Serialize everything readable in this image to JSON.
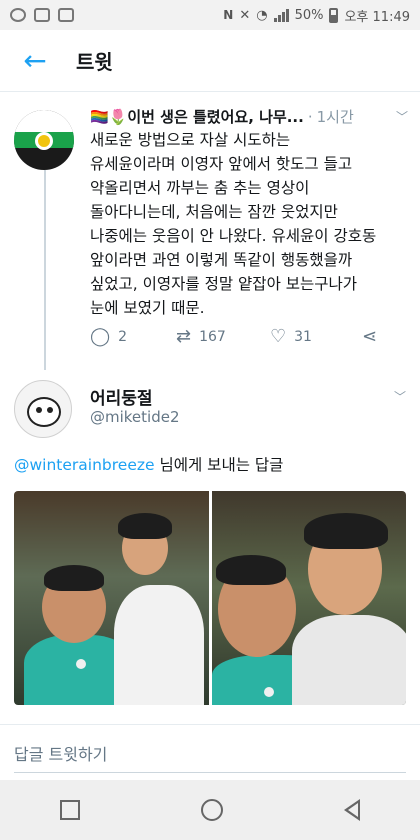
{
  "status_bar": {
    "battery": "50%",
    "time": "오후 11:49"
  },
  "header": {
    "title": "트윗",
    "back_icon": "arrow-left-icon"
  },
  "tweet_main": {
    "display_name": "🏳️‍🌈🌷이번 생은 틀렸어요, 나무...",
    "separator": "·",
    "time": "1시간",
    "body": "새로운 방법으로 자살 시도하는\n유세윤이라며 이영자 앞에서 핫도그 들고\n약올리면서 까부는 춤 추는 영상이\n돌아다니는데, 처음에는 잠깐 웃었지만\n나중에는 웃음이 안 나왔다. 유세윤이 강호동\n앞이라면 과연 이렇게 똑같이 행동했을까\n싶었고, 이영자를 정말 얕잡아 보는구나가\n눈에 보였기 때문.",
    "replies": "2",
    "retweets": "167",
    "likes": "31"
  },
  "tweet_reply": {
    "display_name": "어리둥절",
    "handle": "@miketide2",
    "mention": "@winterainbreeze",
    "reply_to_suffix": " 님에게 보내는 답글"
  },
  "reply_box": {
    "placeholder": "답글 트윗하기"
  },
  "colors": {
    "accent": "#1da1f2",
    "text": "#14171a",
    "muted": "#657786"
  }
}
